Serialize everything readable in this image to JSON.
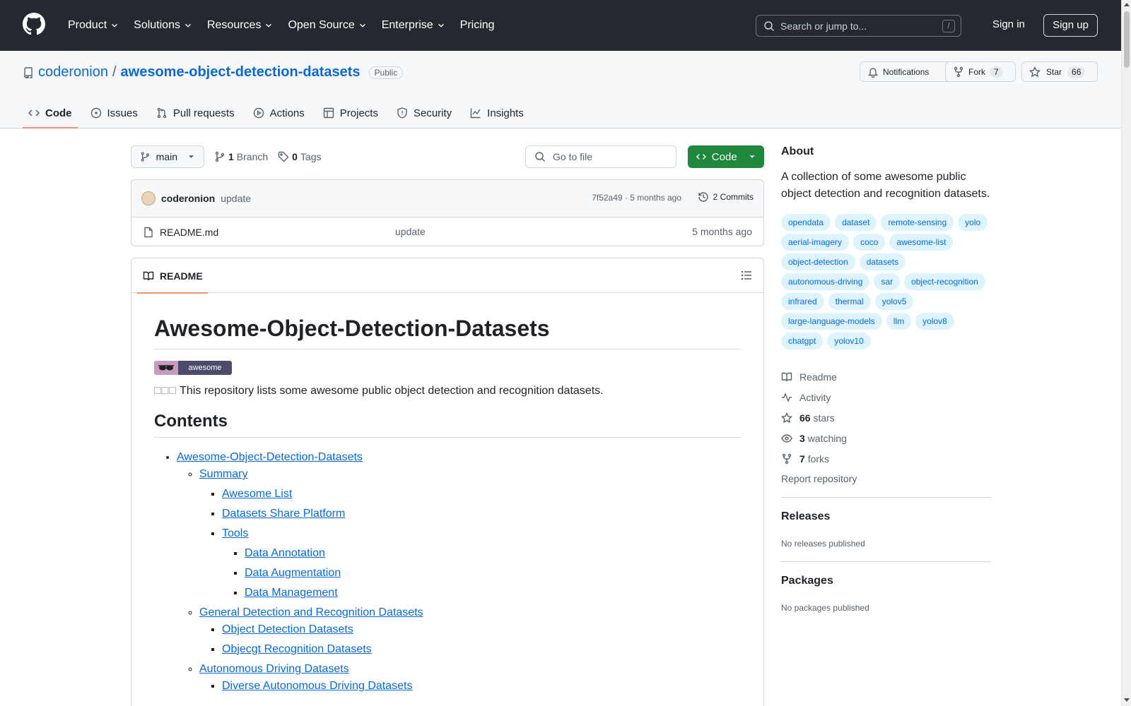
{
  "header": {
    "nav": [
      {
        "label": "Product",
        "has_menu": true
      },
      {
        "label": "Solutions",
        "has_menu": true
      },
      {
        "label": "Resources",
        "has_menu": true
      },
      {
        "label": "Open Source",
        "has_menu": true
      },
      {
        "label": "Enterprise",
        "has_menu": true
      },
      {
        "label": "Pricing",
        "has_menu": false
      }
    ],
    "search_placeholder": "Search or jump to...",
    "search_key": "/",
    "sign_in": "Sign in",
    "sign_up": "Sign up"
  },
  "repo": {
    "owner": "coderonion",
    "separator": "/",
    "name": "awesome-object-detection-datasets",
    "visibility": "Public",
    "notifications_label": "Notifications",
    "fork_label": "Fork",
    "fork_count": "7",
    "star_label": "Star",
    "star_count": "66",
    "tabs": [
      {
        "label": "Code",
        "icon": "code-icon",
        "active": true
      },
      {
        "label": "Issues",
        "icon": "issue-icon",
        "active": false
      },
      {
        "label": "Pull requests",
        "icon": "pull-request-icon",
        "active": false
      },
      {
        "label": "Actions",
        "icon": "play-icon",
        "active": false
      },
      {
        "label": "Projects",
        "icon": "table-icon",
        "active": false
      },
      {
        "label": "Security",
        "icon": "shield-icon",
        "active": false
      },
      {
        "label": "Insights",
        "icon": "graph-icon",
        "active": false
      }
    ]
  },
  "toolbar": {
    "branch": "main",
    "branch_count": "1",
    "branch_label": "Branch",
    "tag_count": "0",
    "tag_label": "Tags",
    "goto_file_placeholder": "Go to file",
    "code_button": "Code"
  },
  "commit": {
    "author": "coderonion",
    "message": "update",
    "hash": "7f52a49",
    "age": "5 months ago",
    "commits_label": "2 Commits"
  },
  "files": [
    {
      "name": "README.md",
      "message": "update",
      "age": "5 months ago"
    }
  ],
  "readme": {
    "tab_label": "README",
    "title": "Awesome-Object-Detection-Datasets",
    "badge_text": "awesome",
    "intro_boxes": "□□□",
    "intro": "This repository lists some awesome public object detection and recognition datasets.",
    "contents_heading": "Contents",
    "toc": {
      "root": "Awesome-Object-Detection-Datasets",
      "summary": "Summary",
      "awesome_list": "Awesome List",
      "share_platform": "Datasets Share Platform",
      "tools": "Tools",
      "data_annotation": "Data Annotation",
      "data_augmentation": "Data Augmentation",
      "data_management": "Data Management",
      "general": "General Detection and Recognition Datasets",
      "object_detection": "Object Detection Datasets",
      "object_recognition": "Objecgt Recognition Datasets",
      "autonomous": "Autonomous Driving Datasets",
      "diverse": "Diverse Autonomous Driving Datasets"
    }
  },
  "about": {
    "heading": "About",
    "description": "A collection of some awesome public object detection and recognition datasets.",
    "topics": [
      "opendata",
      "dataset",
      "remote-sensing",
      "yolo",
      "aerial-imagery",
      "coco",
      "awesome-list",
      "object-detection",
      "datasets",
      "autonomous-driving",
      "sar",
      "object-recognition",
      "infrared",
      "thermal",
      "yolov5",
      "large-language-models",
      "llm",
      "yolov8",
      "chatgpt",
      "yolov10"
    ],
    "readme_label": "Readme",
    "activity_label": "Activity",
    "stars_count": "66",
    "stars_label": "stars",
    "watching_count": "3",
    "watching_label": "watching",
    "forks_count": "7",
    "forks_label": "forks",
    "report_label": "Report repository"
  },
  "releases": {
    "heading": "Releases",
    "empty": "No releases published"
  },
  "packages": {
    "heading": "Packages",
    "empty": "No packages published"
  },
  "colors": {
    "header_bg": "#24292f",
    "link": "#0969da",
    "code_button": "#1f883d",
    "active_tab": "#fd8c73",
    "topic_bg": "#ddf4ff"
  }
}
